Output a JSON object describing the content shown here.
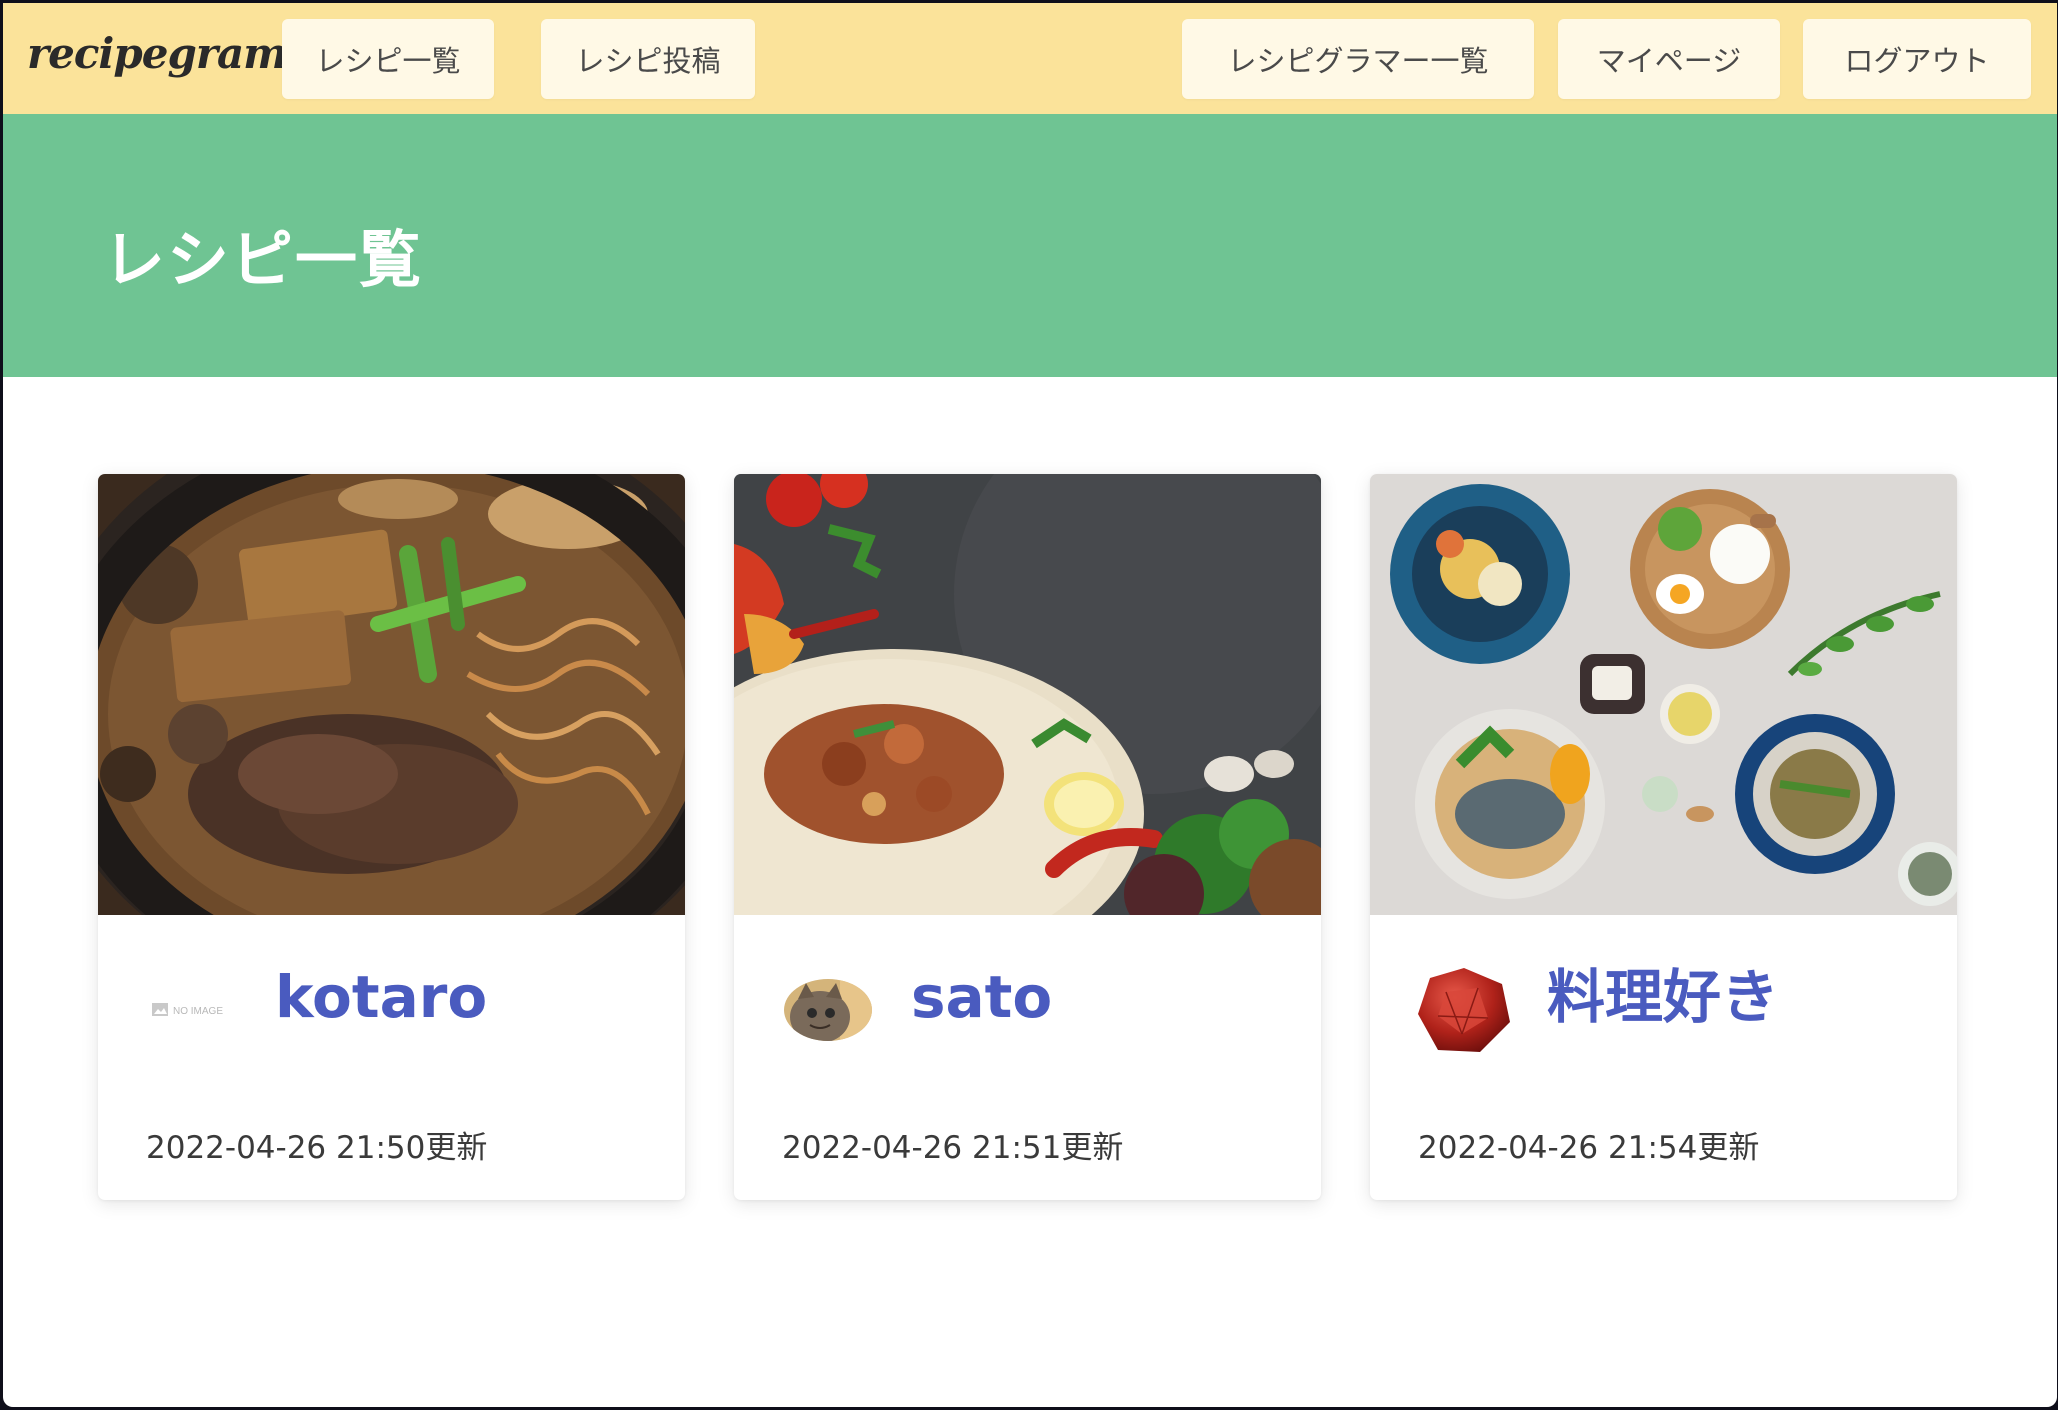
{
  "navbar": {
    "brand": "recipegram",
    "recipes": "レシピ一覧",
    "post": "レシピ投稿",
    "users": "レシピグラマー一覧",
    "mypage": "マイページ",
    "logout": "ログアウト",
    "background": "#fbe39a"
  },
  "hero": {
    "title": "レシピ一覧",
    "background": "#6fc493"
  },
  "cards": [
    {
      "image": "sukiyaki-hotpot-photo",
      "avatar": "no-image-placeholder",
      "avatar_text": "NO IMAGE",
      "author": "kotaro",
      "updated": "2022-04-26 21:50更新"
    },
    {
      "image": "burrito-tortilla-photo",
      "avatar": "cat-photo-avatar",
      "author": "sato",
      "updated": "2022-04-26 21:51更新"
    },
    {
      "image": "plated-dishes-photo",
      "avatar": "ruby-gem-avatar",
      "author": "料理好き",
      "updated": "2022-04-26 21:54更新"
    }
  ],
  "colors": {
    "link": "#4a5bbf",
    "text": "#3a3a3a"
  }
}
